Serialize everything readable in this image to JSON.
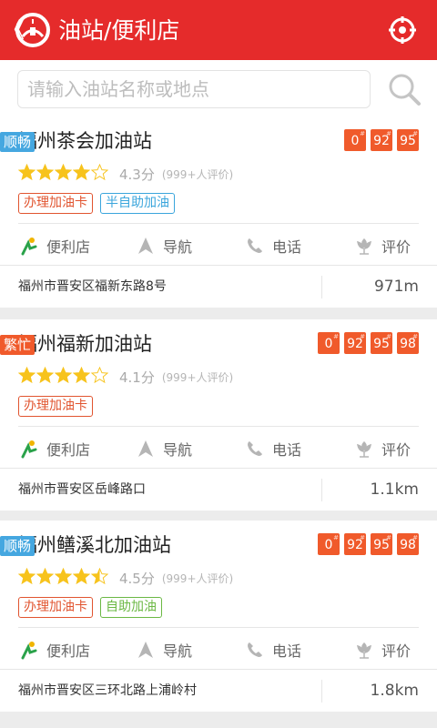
{
  "header": {
    "back_glyph": "《",
    "title": "油站/便利店",
    "logo_icon": "gas-station-logo-icon",
    "right_icon": "locate-target-icon",
    "bg_color": "#e52b2b"
  },
  "search": {
    "placeholder": "请输入油站名称或地点",
    "value": ""
  },
  "colors": {
    "smooth_status": "#45a7e0",
    "busy_status": "#f05a2b",
    "fuel_badge": "#f05a2b",
    "star": "#f7c31c"
  },
  "stations": [
    {
      "name": "福州茶会加油站",
      "status": "顺畅",
      "status_type": "smooth",
      "fuels": [
        "0",
        "92",
        "95"
      ],
      "fuel_mark": "#",
      "stars": 4,
      "rating": "4.3分",
      "reviews": "(999+人评价)",
      "tags": [
        {
          "label": "办理加油卡",
          "type": "red"
        },
        {
          "label": "半自助加油",
          "type": "blue"
        }
      ],
      "actions": [
        "便利店",
        "导航",
        "电话",
        "评价"
      ],
      "address": "福州市晋安区福新东路8号",
      "distance": "971m"
    },
    {
      "name": "福州福新加油站",
      "status": "繁忙",
      "status_type": "busy",
      "fuels": [
        "0",
        "92",
        "95",
        "98"
      ],
      "fuel_mark": "#",
      "stars": 4,
      "rating": "4.1分",
      "reviews": "(999+人评价)",
      "tags": [
        {
          "label": "办理加油卡",
          "type": "red"
        }
      ],
      "actions": [
        "便利店",
        "导航",
        "电话",
        "评价"
      ],
      "address": "福州市晋安区岳峰路口",
      "distance": "1.1km"
    },
    {
      "name": "福州鳝溪北加油站",
      "status": "顺畅",
      "status_type": "smooth",
      "fuels": [
        "0",
        "92",
        "95",
        "98"
      ],
      "fuel_mark": "#",
      "stars": 4.5,
      "rating": "4.5分",
      "reviews": "(999+人评价)",
      "tags": [
        {
          "label": "办理加油卡",
          "type": "red"
        },
        {
          "label": "自助加油",
          "type": "green"
        }
      ],
      "actions": [
        "便利店",
        "导航",
        "电话",
        "评价"
      ],
      "address": "福州市晋安区三环北路上浦岭村",
      "distance": "1.8km"
    }
  ]
}
